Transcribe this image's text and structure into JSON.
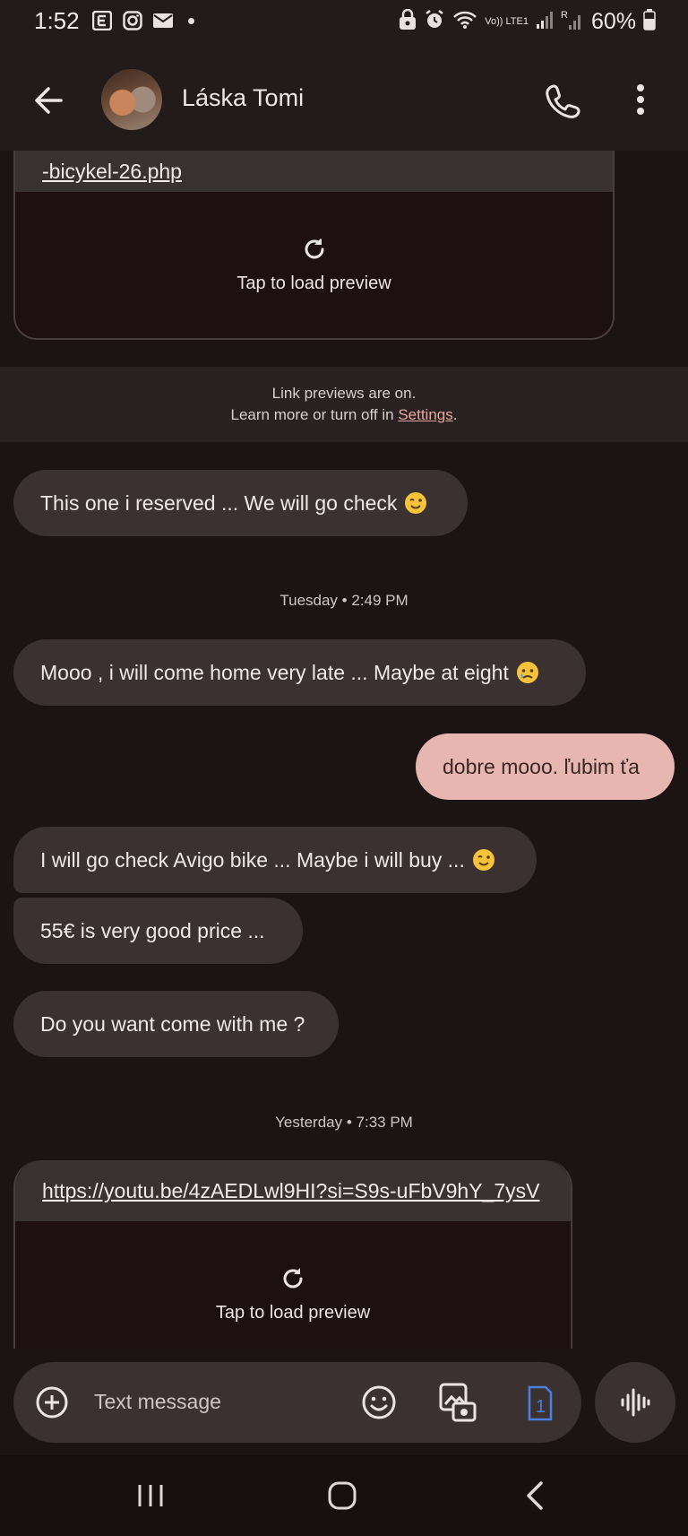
{
  "status_bar": {
    "time": "1:52",
    "battery": "60%",
    "icons": [
      "email-app-icon",
      "instagram-icon",
      "mail-icon",
      "dot",
      "lock-icon",
      "alarm-icon",
      "wifi-icon",
      "volte-icon",
      "signal-icon",
      "roaming-signal-icon",
      "battery-icon"
    ],
    "volte_label": "Vo)) LTE1",
    "roaming_label": "R"
  },
  "app_bar": {
    "contact_name": "Láska Tomi",
    "icons": [
      "back-arrow-icon",
      "avatar",
      "phone-icon",
      "more-vert-icon"
    ]
  },
  "conversation": {
    "top_link": {
      "url": "-bicykel-26.php",
      "preview_label": "Tap to load preview"
    },
    "notice": {
      "line1": "Link previews are on.",
      "line2_prefix": "Learn more or turn off in ",
      "settings_link": "Settings",
      "line2_suffix": "."
    },
    "msg1": {
      "text": "This one i reserved ... We will go check",
      "emoji": "winking-face"
    },
    "timestamp1": "Tuesday • 2:49 PM",
    "msg2": {
      "text": "Mooo , i will come home very late ... Maybe at eight",
      "emoji": "crying-face"
    },
    "msg3": {
      "text": "dobre mooo. ľubim ťa"
    },
    "msg4": {
      "text": "I will go check Avigo bike ... Maybe i will buy ...",
      "emoji": "winking-face"
    },
    "msg5": {
      "text": "55€ is very good price ..."
    },
    "msg6": {
      "text": "Do you want come with me ?"
    },
    "timestamp2": "Yesterday • 7:33 PM",
    "bottom_link": {
      "url": "https://youtu.be/4zAEDLwl9HI?si=S9s-uFbV9hY_7ysV",
      "preview_label": "Tap to load preview"
    }
  },
  "compose": {
    "placeholder": "Text message",
    "sim_label": "1"
  },
  "nav_bar": {
    "icons": [
      "recents-icon",
      "home-icon",
      "back-icon"
    ]
  },
  "colors": {
    "background": "#1c1313",
    "app_bar": "#231a1a",
    "incoming_bubble": "#3b3131",
    "outgoing_bubble": "#e7b6b0",
    "accent_sim": "#4a7fe0"
  }
}
